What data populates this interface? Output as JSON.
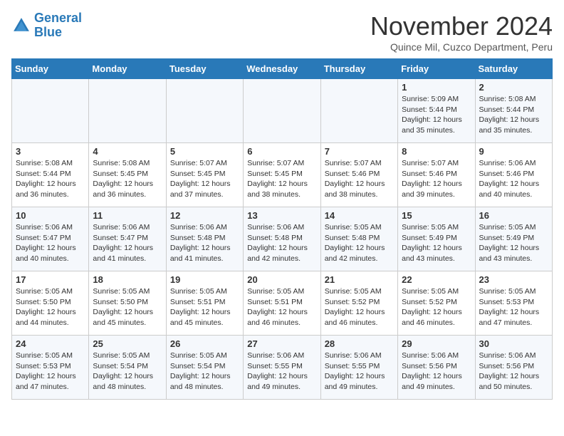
{
  "logo": {
    "line1": "General",
    "line2": "Blue"
  },
  "title": "November 2024",
  "subtitle": "Quince Mil, Cuzco Department, Peru",
  "weekdays": [
    "Sunday",
    "Monday",
    "Tuesday",
    "Wednesday",
    "Thursday",
    "Friday",
    "Saturday"
  ],
  "weeks": [
    [
      {
        "day": "",
        "info": ""
      },
      {
        "day": "",
        "info": ""
      },
      {
        "day": "",
        "info": ""
      },
      {
        "day": "",
        "info": ""
      },
      {
        "day": "",
        "info": ""
      },
      {
        "day": "1",
        "info": "Sunrise: 5:09 AM\nSunset: 5:44 PM\nDaylight: 12 hours\nand 35 minutes."
      },
      {
        "day": "2",
        "info": "Sunrise: 5:08 AM\nSunset: 5:44 PM\nDaylight: 12 hours\nand 35 minutes."
      }
    ],
    [
      {
        "day": "3",
        "info": "Sunrise: 5:08 AM\nSunset: 5:44 PM\nDaylight: 12 hours\nand 36 minutes."
      },
      {
        "day": "4",
        "info": "Sunrise: 5:08 AM\nSunset: 5:45 PM\nDaylight: 12 hours\nand 36 minutes."
      },
      {
        "day": "5",
        "info": "Sunrise: 5:07 AM\nSunset: 5:45 PM\nDaylight: 12 hours\nand 37 minutes."
      },
      {
        "day": "6",
        "info": "Sunrise: 5:07 AM\nSunset: 5:45 PM\nDaylight: 12 hours\nand 38 minutes."
      },
      {
        "day": "7",
        "info": "Sunrise: 5:07 AM\nSunset: 5:46 PM\nDaylight: 12 hours\nand 38 minutes."
      },
      {
        "day": "8",
        "info": "Sunrise: 5:07 AM\nSunset: 5:46 PM\nDaylight: 12 hours\nand 39 minutes."
      },
      {
        "day": "9",
        "info": "Sunrise: 5:06 AM\nSunset: 5:46 PM\nDaylight: 12 hours\nand 40 minutes."
      }
    ],
    [
      {
        "day": "10",
        "info": "Sunrise: 5:06 AM\nSunset: 5:47 PM\nDaylight: 12 hours\nand 40 minutes."
      },
      {
        "day": "11",
        "info": "Sunrise: 5:06 AM\nSunset: 5:47 PM\nDaylight: 12 hours\nand 41 minutes."
      },
      {
        "day": "12",
        "info": "Sunrise: 5:06 AM\nSunset: 5:48 PM\nDaylight: 12 hours\nand 41 minutes."
      },
      {
        "day": "13",
        "info": "Sunrise: 5:06 AM\nSunset: 5:48 PM\nDaylight: 12 hours\nand 42 minutes."
      },
      {
        "day": "14",
        "info": "Sunrise: 5:05 AM\nSunset: 5:48 PM\nDaylight: 12 hours\nand 42 minutes."
      },
      {
        "day": "15",
        "info": "Sunrise: 5:05 AM\nSunset: 5:49 PM\nDaylight: 12 hours\nand 43 minutes."
      },
      {
        "day": "16",
        "info": "Sunrise: 5:05 AM\nSunset: 5:49 PM\nDaylight: 12 hours\nand 43 minutes."
      }
    ],
    [
      {
        "day": "17",
        "info": "Sunrise: 5:05 AM\nSunset: 5:50 PM\nDaylight: 12 hours\nand 44 minutes."
      },
      {
        "day": "18",
        "info": "Sunrise: 5:05 AM\nSunset: 5:50 PM\nDaylight: 12 hours\nand 45 minutes."
      },
      {
        "day": "19",
        "info": "Sunrise: 5:05 AM\nSunset: 5:51 PM\nDaylight: 12 hours\nand 45 minutes."
      },
      {
        "day": "20",
        "info": "Sunrise: 5:05 AM\nSunset: 5:51 PM\nDaylight: 12 hours\nand 46 minutes."
      },
      {
        "day": "21",
        "info": "Sunrise: 5:05 AM\nSunset: 5:52 PM\nDaylight: 12 hours\nand 46 minutes."
      },
      {
        "day": "22",
        "info": "Sunrise: 5:05 AM\nSunset: 5:52 PM\nDaylight: 12 hours\nand 46 minutes."
      },
      {
        "day": "23",
        "info": "Sunrise: 5:05 AM\nSunset: 5:53 PM\nDaylight: 12 hours\nand 47 minutes."
      }
    ],
    [
      {
        "day": "24",
        "info": "Sunrise: 5:05 AM\nSunset: 5:53 PM\nDaylight: 12 hours\nand 47 minutes."
      },
      {
        "day": "25",
        "info": "Sunrise: 5:05 AM\nSunset: 5:54 PM\nDaylight: 12 hours\nand 48 minutes."
      },
      {
        "day": "26",
        "info": "Sunrise: 5:05 AM\nSunset: 5:54 PM\nDaylight: 12 hours\nand 48 minutes."
      },
      {
        "day": "27",
        "info": "Sunrise: 5:06 AM\nSunset: 5:55 PM\nDaylight: 12 hours\nand 49 minutes."
      },
      {
        "day": "28",
        "info": "Sunrise: 5:06 AM\nSunset: 5:55 PM\nDaylight: 12 hours\nand 49 minutes."
      },
      {
        "day": "29",
        "info": "Sunrise: 5:06 AM\nSunset: 5:56 PM\nDaylight: 12 hours\nand 49 minutes."
      },
      {
        "day": "30",
        "info": "Sunrise: 5:06 AM\nSunset: 5:56 PM\nDaylight: 12 hours\nand 50 minutes."
      }
    ]
  ]
}
